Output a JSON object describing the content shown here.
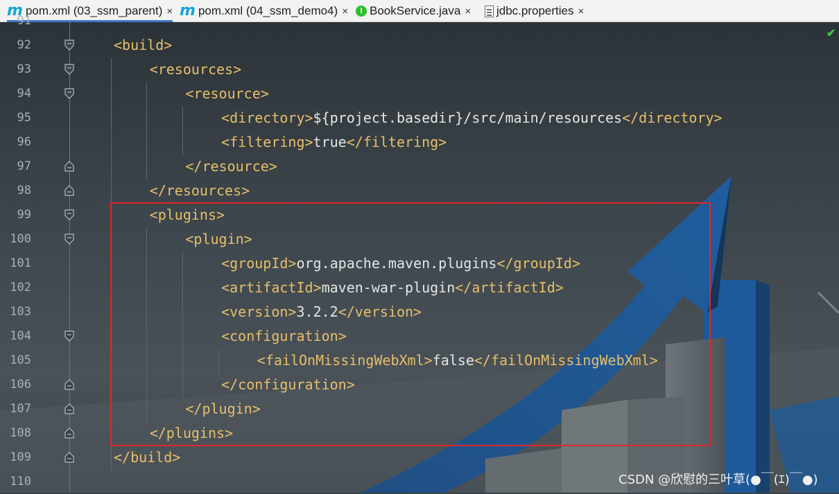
{
  "tabs": [
    {
      "label": "pom.xml (03_ssm_parent)",
      "icon": "maven-m-icon",
      "active": true
    },
    {
      "label": "pom.xml (04_ssm_demo4)",
      "icon": "maven-m-icon",
      "active": false
    },
    {
      "label": "BookService.java",
      "icon": "interface-icon",
      "icon_text": "I",
      "active": false
    },
    {
      "label": "jdbc.properties",
      "icon": "properties-file-icon",
      "active": false
    }
  ],
  "tab_close_glyph": "×",
  "gutter": {
    "partial_top_line": "91",
    "lines": [
      "92",
      "93",
      "94",
      "95",
      "96",
      "97",
      "98",
      "99",
      "100",
      "101",
      "102",
      "103",
      "104",
      "105",
      "106",
      "107",
      "108",
      "109",
      "110"
    ]
  },
  "code": [
    {
      "tag_open": "<build>",
      "text": "",
      "tag_close": ""
    },
    {
      "tag_open": "<resources>",
      "text": "",
      "tag_close": ""
    },
    {
      "tag_open": "<resource>",
      "text": "",
      "tag_close": ""
    },
    {
      "tag_open": "<directory>",
      "text": "${project.basedir}/src/main/resources",
      "tag_close": "</directory>"
    },
    {
      "tag_open": "<filtering>",
      "text": "true",
      "tag_close": "</filtering>"
    },
    {
      "tag_open": "</resource>",
      "text": "",
      "tag_close": ""
    },
    {
      "tag_open": "</resources>",
      "text": "",
      "tag_close": ""
    },
    {
      "tag_open": "<plugins>",
      "text": "",
      "tag_close": ""
    },
    {
      "tag_open": "<plugin>",
      "text": "",
      "tag_close": ""
    },
    {
      "tag_open": "<groupId>",
      "text": "org.apache.maven.plugins",
      "tag_close": "</groupId>"
    },
    {
      "tag_open": "<artifactId>",
      "text": "maven-war-plugin",
      "tag_close": "</artifactId>"
    },
    {
      "tag_open": "<version>",
      "text": "3.2.2",
      "tag_close": "</version>"
    },
    {
      "tag_open": "<configuration>",
      "text": "",
      "tag_close": ""
    },
    {
      "tag_open": "<failOnMissingWebXml>",
      "text": "false",
      "tag_close": "</failOnMissingWebXml>"
    },
    {
      "tag_open": "</configuration>",
      "text": "",
      "tag_close": ""
    },
    {
      "tag_open": "</plugin>",
      "text": "",
      "tag_close": ""
    },
    {
      "tag_open": "</plugins>",
      "text": "",
      "tag_close": ""
    },
    {
      "tag_open": "</build>",
      "text": "",
      "tag_close": ""
    },
    {
      "tag_open": "",
      "text": "",
      "tag_close": ""
    }
  ],
  "status": {
    "check_glyph": "✔"
  },
  "watermark": "CSDN @欣慰的三叶草(●￣(ｴ)￣●)",
  "colors": {
    "tag": "#e8bf6a",
    "text": "#e6e6e6",
    "highlight_box": "#e0262b",
    "line_number": "#a9b0b6"
  }
}
